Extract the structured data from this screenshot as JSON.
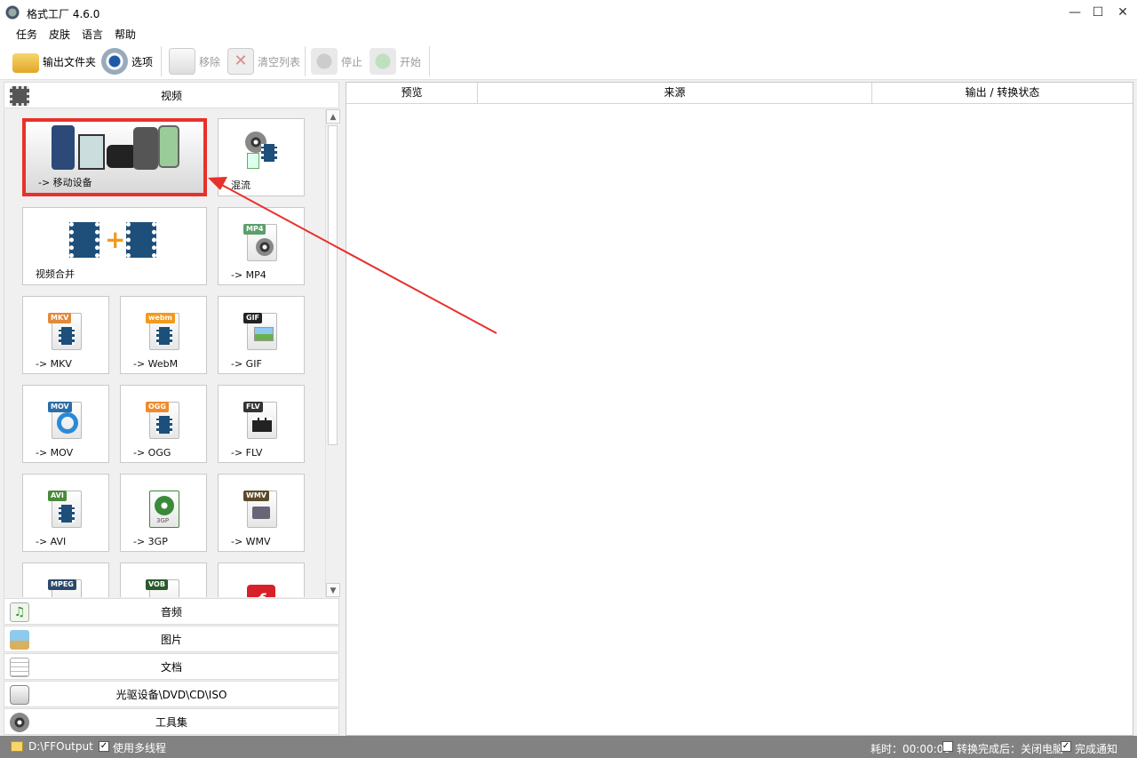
{
  "window": {
    "title": "格式工厂 4.6.0",
    "minimize": "—",
    "maximize": "☐",
    "close": "✕"
  },
  "menu": [
    "任务",
    "皮肤",
    "语言",
    "帮助"
  ],
  "toolbar": {
    "output_folder": "输出文件夹",
    "options": "选项",
    "remove": "移除",
    "clear_list": "清空列表",
    "stop": "停止",
    "start": "开始"
  },
  "categories": {
    "video": "视频",
    "audio": "音频",
    "image": "图片",
    "document": "文档",
    "optical": "光驱设备\\DVD\\CD\\ISO",
    "tools": "工具集"
  },
  "tiles": {
    "mobile": "-> 移动设备",
    "mux": "混流",
    "merge": "视频合并",
    "mp4": "-> MP4",
    "mkv": "-> MKV",
    "webm": "-> WebM",
    "gif": "-> GIF",
    "mov": "-> MOV",
    "ogg": "-> OGG",
    "flv": "-> FLV",
    "avi": "-> AVI",
    "3gp": "-> 3GP",
    "wmv": "-> WMV"
  },
  "tile_tags": {
    "mp4": "MP4",
    "mkv": "MKV",
    "webm": "webm",
    "gif": "GIF",
    "mov": "MOV",
    "ogg": "OGG",
    "flv": "FLV",
    "avi": "AVI",
    "3gp": "3GP",
    "wmv": "WMV",
    "mpeg": "MPEG",
    "vob": "VOB"
  },
  "table_headers": [
    "预览",
    "来源",
    "输出 / 转换状态"
  ],
  "status": {
    "output_path": "D:\\FFOutput",
    "multithread": "使用多线程",
    "elapsed": "耗时：00:00:00",
    "after_convert": "转换完成后：关闭电脑",
    "notify": "完成通知"
  },
  "colors": {
    "highlight": "#e8312b",
    "arrow": "#e8312b",
    "status_bg": "#828282"
  }
}
